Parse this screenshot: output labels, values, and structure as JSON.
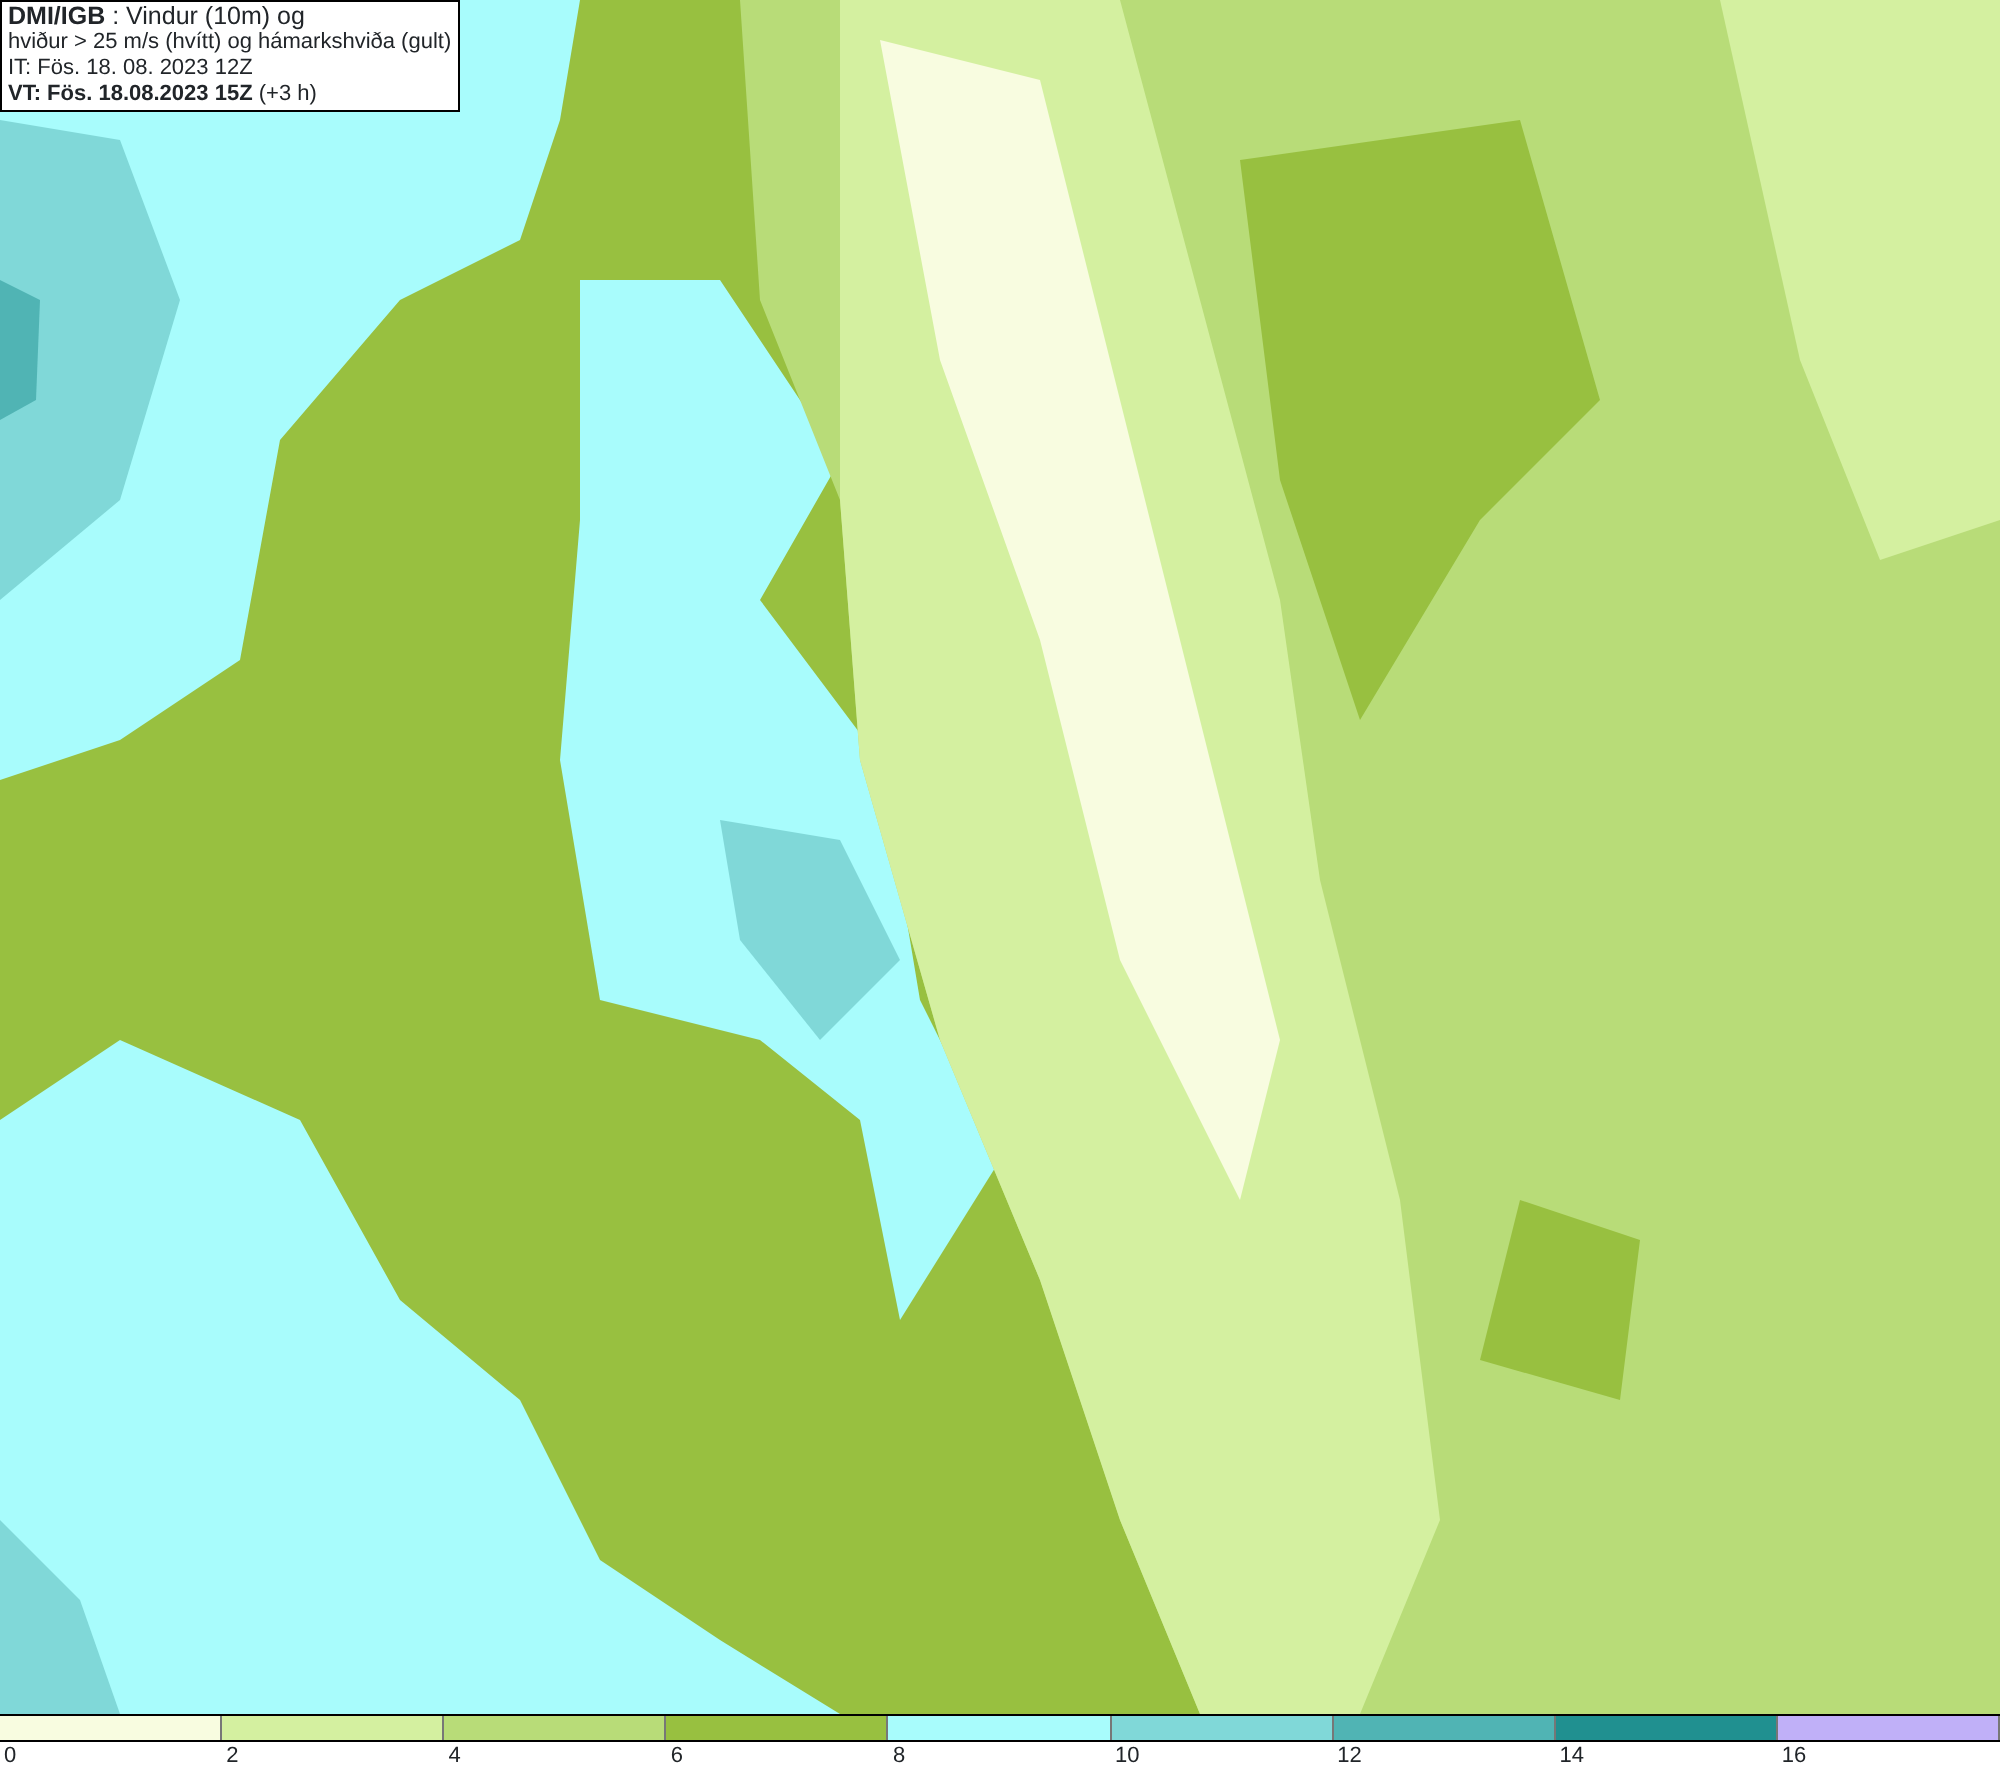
{
  "title_box": {
    "lines": [
      "**DMI/IGB** : Vindur (10m) og",
      "hviður > 25 m/s (hvítt) og hámarkshviða (gult)",
      "IT: Fös. 18. 08. 2023 12Z",
      "**VT: Fös. 18.08.2023 15Z** (+3 h)"
    ]
  },
  "legend": {
    "bins": [
      {
        "color": "#f8fce0",
        "label": "0"
      },
      {
        "color": "#d4f0a0",
        "label": "2"
      },
      {
        "color": "#b8dc78",
        "label": "4"
      },
      {
        "color": "#98c040",
        "label": "6"
      },
      {
        "color": "#a8fcfc",
        "label": "8"
      },
      {
        "color": "#80d8d8",
        "label": "10"
      },
      {
        "color": "#50b4b4",
        "label": "12"
      },
      {
        "color": "#209090",
        "label": "14"
      },
      {
        "color": "#c0b0f8",
        "label": "16"
      }
    ]
  }
}
